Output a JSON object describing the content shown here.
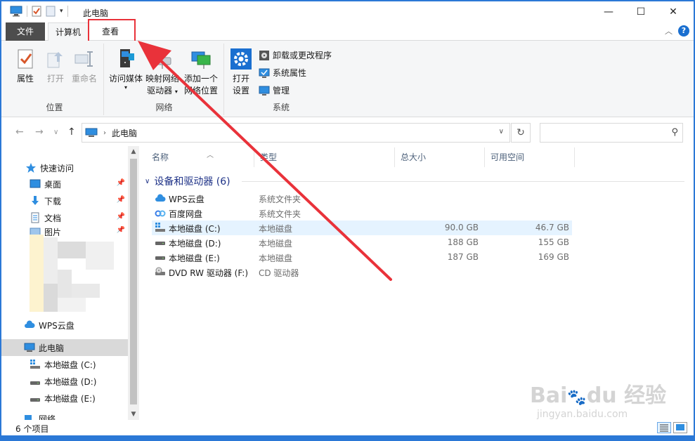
{
  "window": {
    "title": "此电脑",
    "minimize_glyph": "—",
    "maximize_glyph": "☐",
    "close_glyph": "✕"
  },
  "ribbon_tabs": {
    "file": "文件",
    "computer": "计算机",
    "view": "查看",
    "help_glyph": "?"
  },
  "ribbon": {
    "groups": {
      "location": "位置",
      "network": "网络",
      "system": "系统"
    },
    "buttons": {
      "properties": "属性",
      "open": "打开",
      "rename": "重命名",
      "access_media": "访问媒体",
      "map_drive_1": "映射网络",
      "map_drive_2": "驱动器",
      "add_location_1": "添加一个",
      "add_location_2": "网络位置",
      "open_settings_1": "打开",
      "open_settings_2": "设置",
      "uninstall": "卸载或更改程序",
      "system_properties": "系统属性",
      "manage": "管理"
    }
  },
  "address": {
    "path": "此电脑",
    "search_placeholder": ""
  },
  "nav_pane": {
    "quick_access": "快速访问",
    "desktop": "桌面",
    "downloads": "下载",
    "documents": "文档",
    "pictures": "图片",
    "wps_cloud": "WPS云盘",
    "this_pc": "此电脑",
    "local_c": "本地磁盘 (C:)",
    "local_d": "本地磁盘 (D:)",
    "local_e": "本地磁盘 (E:)",
    "network": "网络"
  },
  "columns": {
    "name": "名称",
    "type": "类型",
    "total_size": "总大小",
    "free_space": "可用空间"
  },
  "group_header": "设备和驱动器 (6)",
  "drives": [
    {
      "name": "WPS云盘",
      "type": "系统文件夹",
      "total": "",
      "free": "",
      "icon": "cloud-icon"
    },
    {
      "name": "百度网盘",
      "type": "系统文件夹",
      "total": "",
      "free": "",
      "icon": "baidu-netdisk-icon"
    },
    {
      "name": "本地磁盘 (C:)",
      "type": "本地磁盘",
      "total": "90.0 GB",
      "free": "46.7 GB",
      "icon": "windows-drive-icon"
    },
    {
      "name": "本地磁盘 (D:)",
      "type": "本地磁盘",
      "total": "188 GB",
      "free": "155 GB",
      "icon": "hard-drive-icon"
    },
    {
      "name": "本地磁盘 (E:)",
      "type": "本地磁盘",
      "total": "187 GB",
      "free": "169 GB",
      "icon": "hard-drive-icon"
    },
    {
      "name": "DVD RW 驱动器 (F:)",
      "type": "CD 驱动器",
      "total": "",
      "free": "",
      "icon": "dvd-drive-icon"
    }
  ],
  "status": {
    "item_count": "6 个项目"
  },
  "colors": {
    "accent": "#2b78d6",
    "annotation_red": "#e9323a",
    "selected_row": "#e5f3ff"
  }
}
